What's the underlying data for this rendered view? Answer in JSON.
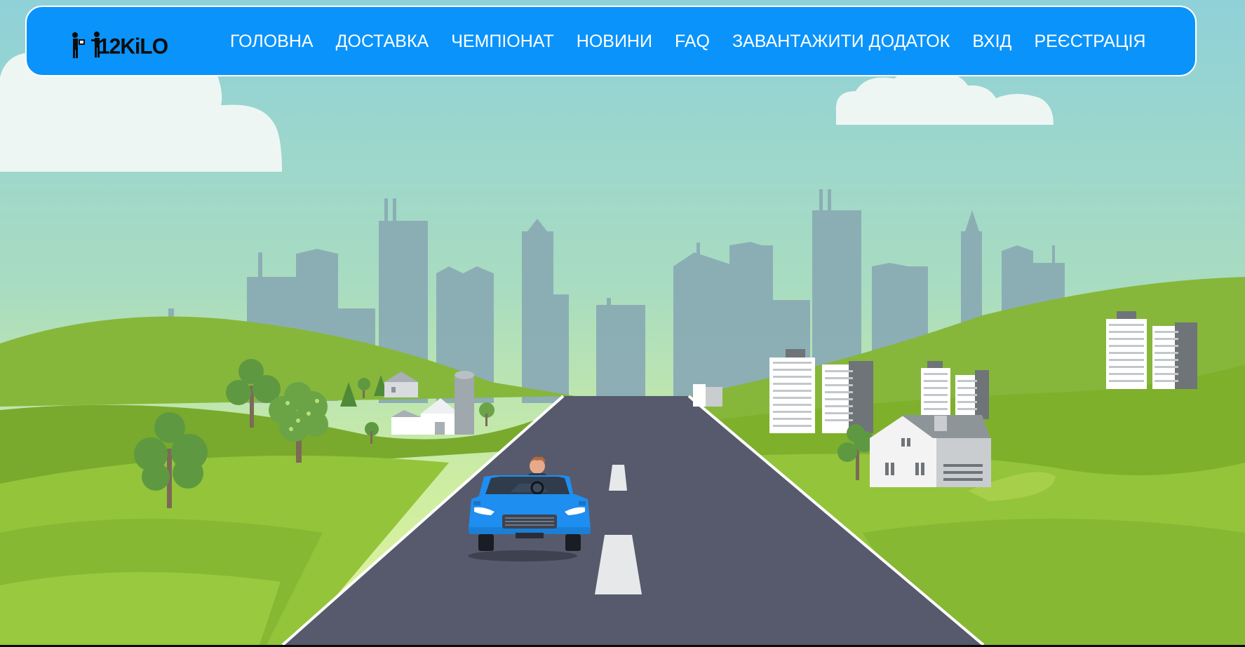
{
  "brand": {
    "logo_text": "12KiLO",
    "logo_label": "12KiLO"
  },
  "nav": {
    "items": [
      {
        "label": "ГОЛОВНА"
      },
      {
        "label": "ДОСТАВКА"
      },
      {
        "label": "ЧЕМПІОНАТ"
      },
      {
        "label": "НОВИНИ"
      },
      {
        "label": "FAQ"
      },
      {
        "label": "ЗАВАНТАЖИТИ ДОДАТОК"
      },
      {
        "label": "ВХІД"
      },
      {
        "label": "РЕЄСТРАЦІЯ"
      }
    ]
  },
  "theme": {
    "navbar_bg": "#0a93fb",
    "navbar_border": "#ffffff",
    "nav_text": "#ffffff",
    "sky_top": "#8fd3d8",
    "sky_bottom": "#d9f0a0",
    "grass_light": "#9bc83a",
    "grass_dark": "#6e9e24",
    "road": "#575a6c",
    "car": "#1e8ef0"
  },
  "hero": {
    "scene": "cartoon road into city with blue car",
    "icons": [
      "cloud-icon",
      "city-skyline-icon",
      "tree-icon",
      "farm-icon",
      "building-icon",
      "house-icon",
      "car-icon",
      "driver-icon"
    ]
  }
}
